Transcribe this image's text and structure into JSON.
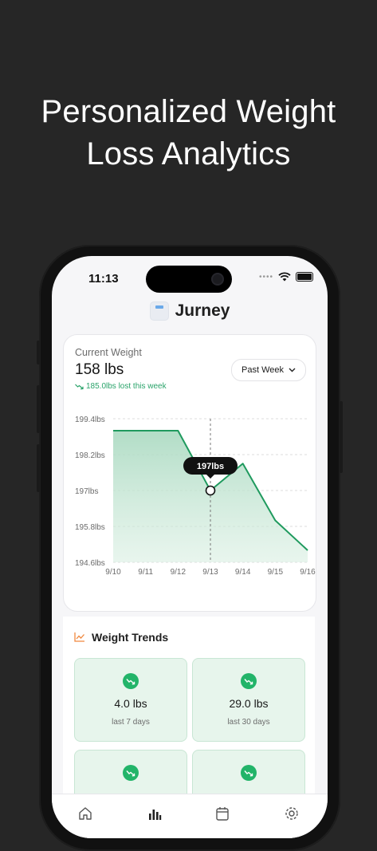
{
  "headline": {
    "line1": "Personalized Weight",
    "line2": "Loss Analytics"
  },
  "status_bar": {
    "time": "11:13"
  },
  "app": {
    "name": "Jurney"
  },
  "current_weight": {
    "label": "Current Weight",
    "value": "158 lbs",
    "lost_text": "185.0lbs lost this week",
    "period_button": "Past Week"
  },
  "colors": {
    "accent_green": "#22b469",
    "trend_orange": "#f0883e",
    "line": "#1f9a5e"
  },
  "chart_data": {
    "type": "area",
    "x": [
      "9/10",
      "9/11",
      "9/12",
      "9/13",
      "9/14",
      "9/15",
      "9/16"
    ],
    "values": [
      199.0,
      199.0,
      199.0,
      197.0,
      197.9,
      196.0,
      195.0
    ],
    "y_ticks": [
      "199.4lbs",
      "198.2lbs",
      "197lbs",
      "195.8lbs",
      "194.6lbs"
    ],
    "ylim": [
      194.6,
      199.4
    ],
    "grid": true,
    "tooltip": {
      "category": "9/13",
      "label": "197lbs"
    }
  },
  "trends": {
    "title": "Weight Trends",
    "cards": [
      {
        "value": "4.0 lbs",
        "label": "last 7 days"
      },
      {
        "value": "29.0 lbs",
        "label": "last 30 days"
      }
    ]
  },
  "tabs": [
    "home-icon",
    "chart-icon",
    "calendar-icon",
    "settings-icon"
  ]
}
